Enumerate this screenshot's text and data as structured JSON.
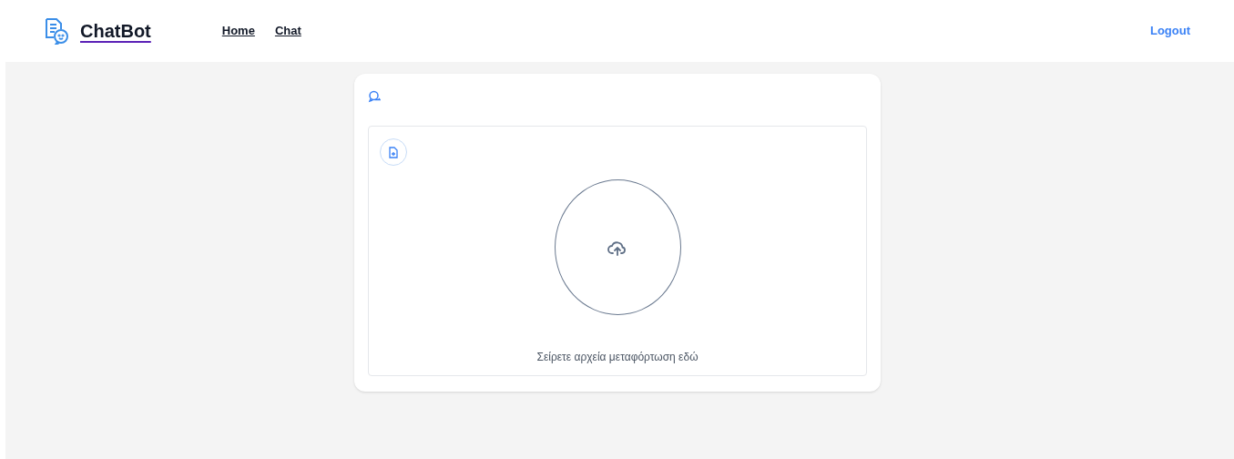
{
  "brand": "ChatBot",
  "nav": [
    {
      "label": "Home"
    },
    {
      "label": "Chat"
    }
  ],
  "logout": "Logout",
  "dropzone": {
    "hint": "Σείρετε αρχεία μεταφόρτωση εδώ"
  }
}
